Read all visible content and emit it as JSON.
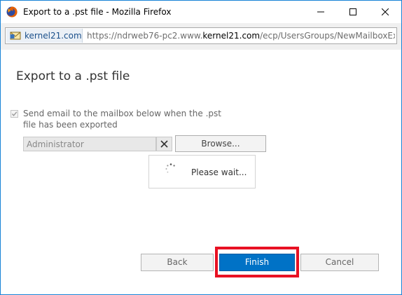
{
  "window": {
    "title": "Export to a .pst file - Mozilla Firefox"
  },
  "address_bar": {
    "site_label": "kernel21.com",
    "url_prefix": "https://ndrweb76-pc2.www.",
    "url_domain": "kernel21.com",
    "url_suffix": "/ecp/UsersGroups/NewMailboxExportR"
  },
  "page": {
    "title": "Export to a .pst file",
    "send_email_label": "Send email to the mailbox below when the .pst file has been exported",
    "send_email_checked": true,
    "mailbox_value": "Administrator",
    "browse_label": "Browse...",
    "wait_text": "Please wait..."
  },
  "footer": {
    "back_label": "Back",
    "finish_label": "Finish",
    "cancel_label": "Cancel"
  },
  "colors": {
    "window_border": "#1883d7",
    "finish_button": "#0072c6",
    "highlight": "#e81123"
  },
  "icons": {
    "app": "firefox-icon",
    "site": "mail-icon",
    "clear": "close-x-icon",
    "spinner": "loading-spinner-icon"
  }
}
